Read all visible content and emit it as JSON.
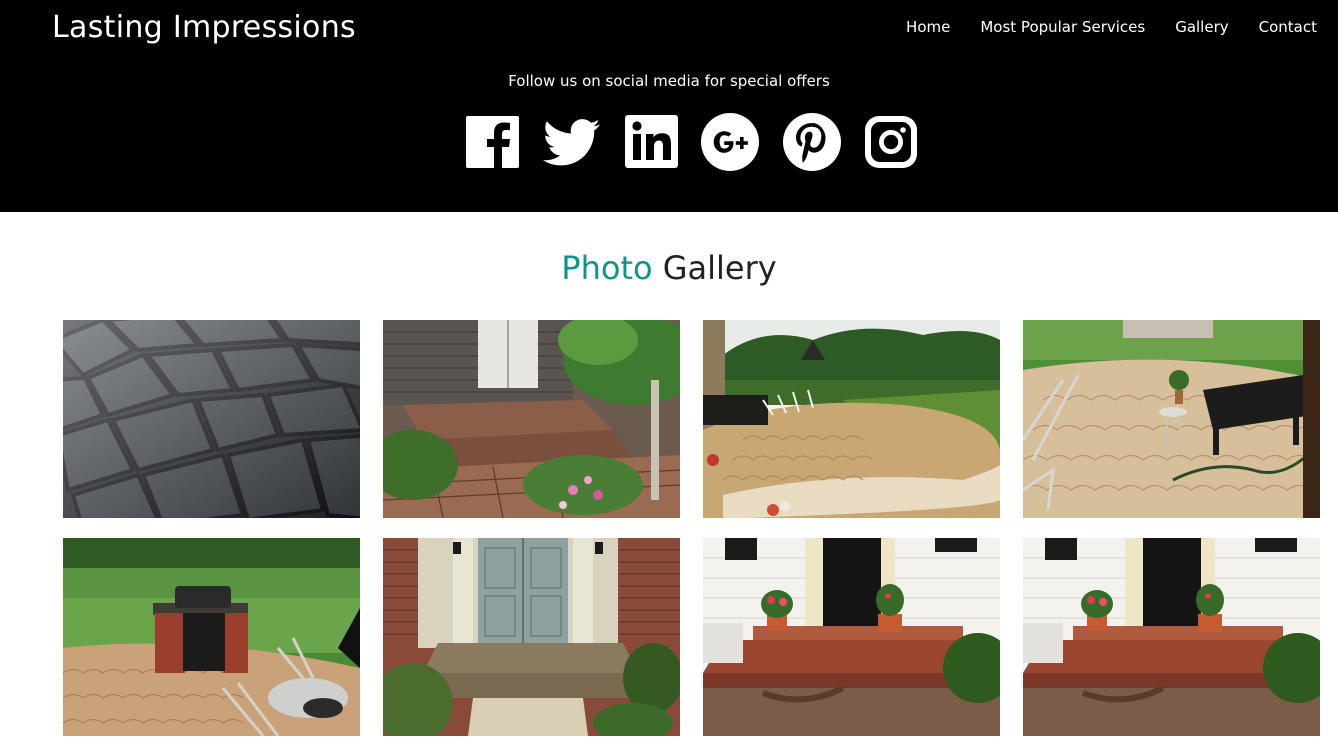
{
  "header": {
    "brand": "Lasting Impressions",
    "nav": [
      "Home",
      "Most Popular Services",
      "Gallery",
      "Contact"
    ],
    "follow_text": "Follow us on social media for special offers",
    "social": [
      "facebook-icon",
      "twitter-icon",
      "linkedin-icon",
      "google-plus-icon",
      "pinterest-icon",
      "instagram-icon"
    ]
  },
  "gallery": {
    "title_accent": "Photo",
    "title_rest": "Gallery",
    "accent_color": "#13918a",
    "photos": [
      "stamped-concrete-ashlar-slate",
      "brick-stamped-front-steps",
      "fan-stamped-patio-with-lawn",
      "fan-stamped-patio-with-bench",
      "patio-with-grill-island",
      "stamped-front-entry-steps",
      "stamped-porch-with-planters",
      "stamped-porch-with-planters-duplicate"
    ]
  }
}
